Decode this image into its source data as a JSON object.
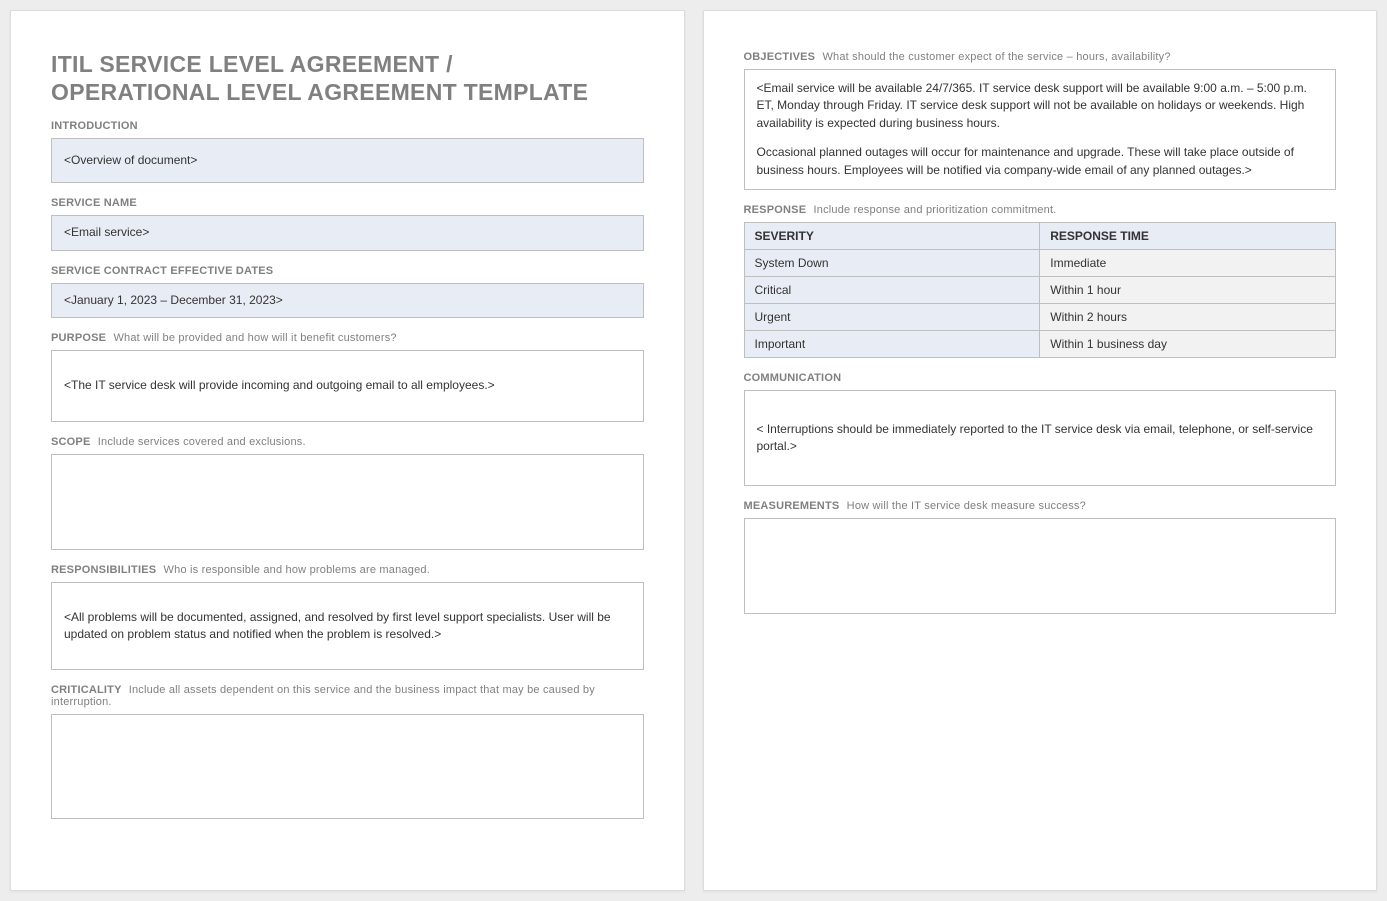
{
  "title_line1": "ITIL SERVICE LEVEL AGREEMENT /",
  "title_line2": "OPERATIONAL LEVEL AGREEMENT TEMPLATE",
  "left": {
    "introduction": {
      "label": "INTRODUCTION",
      "value": "<Overview of document>"
    },
    "service_name": {
      "label": "SERVICE NAME",
      "value": "<Email service>"
    },
    "effective_dates": {
      "label": "SERVICE CONTRACT EFFECTIVE DATES",
      "value": "<January 1, 2023 – December 31, 2023>"
    },
    "purpose": {
      "label": "PURPOSE",
      "hint": "What will be provided and how will it benefit customers?",
      "value": "<The IT service desk will provide incoming and outgoing email to all employees.>"
    },
    "scope": {
      "label": "SCOPE",
      "hint": "Include services covered and exclusions.",
      "value": ""
    },
    "responsibilities": {
      "label": "RESPONSIBILITIES",
      "hint": "Who is responsible and how problems are managed.",
      "value": "<All problems will be documented, assigned, and resolved by first level support specialists. User will be updated on problem status and notified when the problem is resolved.>"
    },
    "criticality": {
      "label": "CRITICALITY",
      "hint": "Include all assets dependent on this service and the business impact that may be caused by interruption.",
      "value": ""
    }
  },
  "right": {
    "objectives": {
      "label": "OBJECTIVES",
      "hint": "What should the customer expect of the service – hours, availability?",
      "p1": "<Email service will be available 24/7/365. IT service desk support will be available 9:00 a.m. – 5:00 p.m. ET, Monday through Friday. IT service desk support will not be available on holidays or weekends. High availability is expected during business hours.",
      "p2": "Occasional planned outages will occur for maintenance and upgrade. These will take place outside of business hours. Employees will be notified via company-wide email of any planned outages.>"
    },
    "response": {
      "label": "RESPONSE",
      "hint": "Include response and prioritization commitment.",
      "headers": {
        "severity": "SEVERITY",
        "time": "RESPONSE TIME"
      },
      "rows": [
        {
          "severity": "System Down",
          "time": "Immediate"
        },
        {
          "severity": "Critical",
          "time": "Within 1 hour"
        },
        {
          "severity": "Urgent",
          "time": "Within 2 hours"
        },
        {
          "severity": "Important",
          "time": "Within 1 business day"
        }
      ]
    },
    "communication": {
      "label": "COMMUNICATION",
      "value": "< Interruptions should be immediately reported to the IT service desk via email, telephone, or self-service portal.>"
    },
    "measurements": {
      "label": "MEASUREMENTS",
      "hint": "How will the IT service desk measure success?",
      "value": ""
    }
  }
}
